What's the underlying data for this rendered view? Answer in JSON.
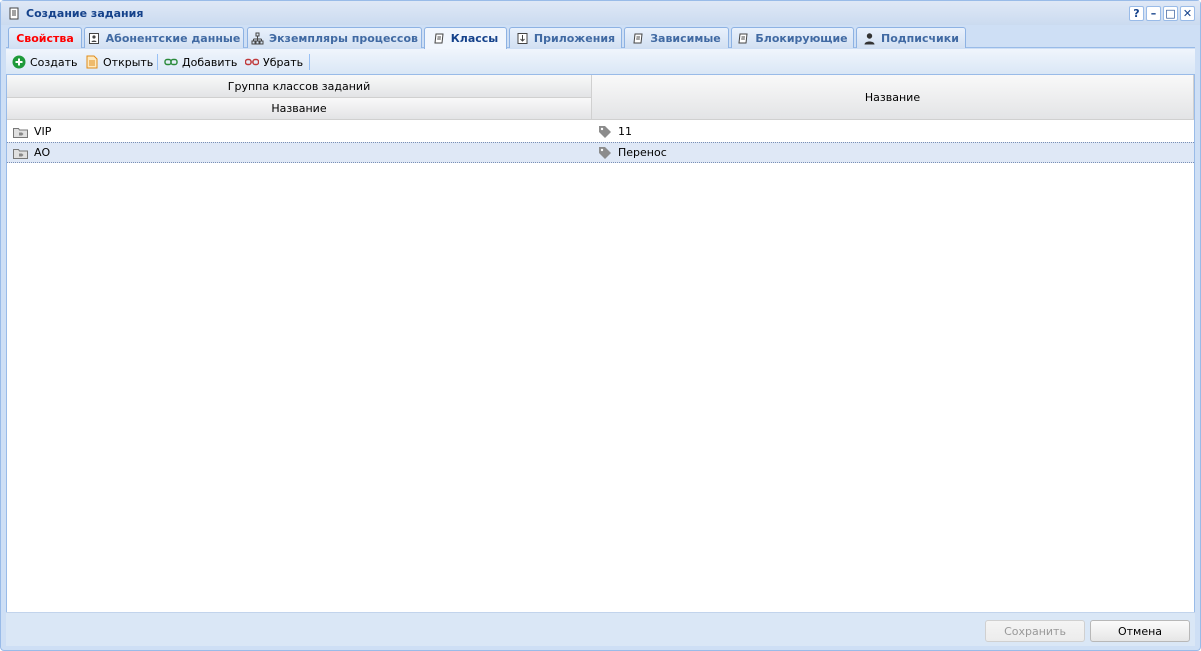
{
  "window": {
    "title": "Создание задания",
    "tools": [
      "?",
      "–",
      "□",
      "✕"
    ]
  },
  "tabs": [
    {
      "label": "Свойства",
      "icon": "none",
      "active": false
    },
    {
      "label": "Абонентские данные",
      "icon": "contact-card-icon",
      "active": false
    },
    {
      "label": "Экземпляры процессов",
      "icon": "process-tree-icon",
      "active": false
    },
    {
      "label": "Классы",
      "icon": "scroll-icon",
      "active": true
    },
    {
      "label": "Приложения",
      "icon": "download-doc-icon",
      "active": false
    },
    {
      "label": "Зависимые",
      "icon": "scroll-icon",
      "active": false
    },
    {
      "label": "Блокирующие",
      "icon": "scroll-icon",
      "active": false
    },
    {
      "label": "Подписчики",
      "icon": "user-icon",
      "active": false
    }
  ],
  "toolbar": {
    "create_label": "Создать",
    "open_label": "Открыть",
    "add_label": "Добавить",
    "remove_label": "Убрать"
  },
  "grid": {
    "group_header": "Группа классов заданий",
    "col1_header": "Название",
    "col2_header": "Название",
    "rows": [
      {
        "group": "VIP",
        "name": "11",
        "selected": false
      },
      {
        "group": "АО",
        "name": "Перенос",
        "selected": true
      }
    ]
  },
  "footer": {
    "save_label": "Сохранить",
    "cancel_label": "Отмена"
  },
  "colors": {
    "title_text": "#15428b",
    "active_tab_red": "#ff0000",
    "selected_row": "#dfe8f6"
  }
}
